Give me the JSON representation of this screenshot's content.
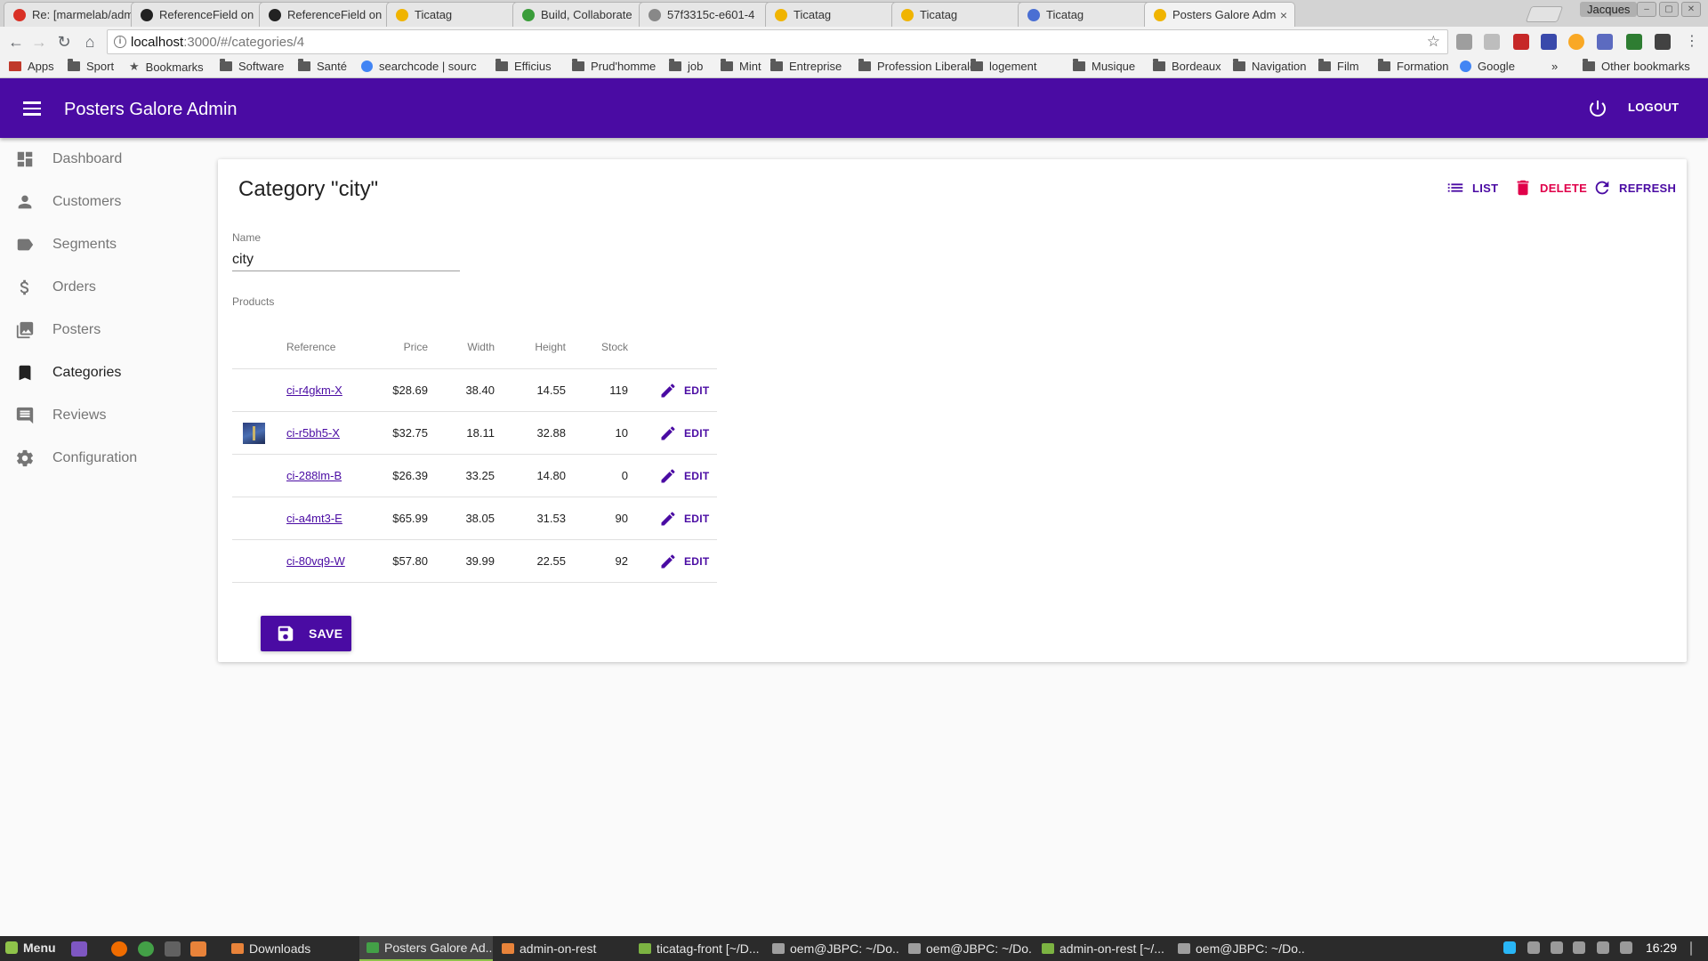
{
  "browser": {
    "tabs": [
      {
        "title": "Re: [marmelab/admin-on-rest",
        "favicon_color": "#d93025"
      },
      {
        "title": "ReferenceField on",
        "favicon_color": "#222222"
      },
      {
        "title": "ReferenceField on",
        "favicon_color": "#222222"
      },
      {
        "title": "Ticatag",
        "favicon_color": "#f0b400"
      },
      {
        "title": "Build, Collaborate",
        "favicon_color": "#3a9d3a"
      },
      {
        "title": "57f3315c-e601-4",
        "favicon_color": "#888888"
      },
      {
        "title": "Ticatag",
        "favicon_color": "#f0b400"
      },
      {
        "title": "Ticatag",
        "favicon_color": "#f0b400"
      },
      {
        "title": "Ticatag",
        "favicon_color": "#4a6fd3"
      },
      {
        "title": "Posters Galore Admin",
        "favicon_color": "#f0b400"
      }
    ],
    "user": "Jacques",
    "url_host": "localhost",
    "url_path": ":3000/#/categories/4",
    "bookmarks": [
      {
        "label": "Apps",
        "type": "apps"
      },
      {
        "label": "Sport",
        "type": "folder"
      },
      {
        "label": "Bookmarks",
        "type": "star"
      },
      {
        "label": "Software",
        "type": "folder"
      },
      {
        "label": "Santé",
        "type": "folder"
      },
      {
        "label": "searchcode | sourc",
        "type": "site"
      },
      {
        "label": "Efficius",
        "type": "folder"
      },
      {
        "label": "Prud'homme",
        "type": "folder"
      },
      {
        "label": "job",
        "type": "folder"
      },
      {
        "label": "Mint",
        "type": "folder"
      },
      {
        "label": "Entreprise",
        "type": "folder"
      },
      {
        "label": "Profession Liberale",
        "type": "folder"
      },
      {
        "label": "logement",
        "type": "folder"
      },
      {
        "label": "Musique",
        "type": "folder"
      },
      {
        "label": "Bordeaux",
        "type": "folder"
      },
      {
        "label": "Navigation",
        "type": "folder"
      },
      {
        "label": "Film",
        "type": "folder"
      },
      {
        "label": "Formation",
        "type": "folder"
      },
      {
        "label": "Google",
        "type": "site"
      },
      {
        "label": "»",
        "type": "more"
      },
      {
        "label": "Other bookmarks",
        "type": "folder"
      }
    ]
  },
  "app": {
    "title": "Posters Galore Admin",
    "logout_label": "LOGOUT",
    "accent_color": "#4a0ba3",
    "danger_color": "#e0004a"
  },
  "sidebar": {
    "items": [
      {
        "label": "Dashboard",
        "icon": "dashboard-icon",
        "active": false
      },
      {
        "label": "Customers",
        "icon": "person-icon",
        "active": false
      },
      {
        "label": "Segments",
        "icon": "label-icon",
        "active": false
      },
      {
        "label": "Orders",
        "icon": "dollar-icon",
        "active": false
      },
      {
        "label": "Posters",
        "icon": "collections-icon",
        "active": false
      },
      {
        "label": "Categories",
        "icon": "bookmark-icon",
        "active": true
      },
      {
        "label": "Reviews",
        "icon": "comment-icon",
        "active": false
      },
      {
        "label": "Configuration",
        "icon": "settings-icon",
        "active": false
      }
    ]
  },
  "page": {
    "title": "Category \"city\"",
    "actions": {
      "list": "LIST",
      "delete": "DELETE",
      "refresh": "REFRESH"
    },
    "name_label": "Name",
    "name_value": "city",
    "products_label": "Products",
    "save_label": "SAVE"
  },
  "products": {
    "columns": [
      "Reference",
      "Price",
      "Width",
      "Height",
      "Stock"
    ],
    "edit_label": "EDIT",
    "rows": [
      {
        "reference": "ci-r4gkm-X",
        "price": "$28.69",
        "width": "38.40",
        "height": "14.55",
        "stock": "119",
        "thumb": false
      },
      {
        "reference": "ci-r5bh5-X",
        "price": "$32.75",
        "width": "18.11",
        "height": "32.88",
        "stock": "10",
        "thumb": true
      },
      {
        "reference": "ci-288lm-B",
        "price": "$26.39",
        "width": "33.25",
        "height": "14.80",
        "stock": "0",
        "thumb": false
      },
      {
        "reference": "ci-a4mt3-E",
        "price": "$65.99",
        "width": "38.05",
        "height": "31.53",
        "stock": "90",
        "thumb": false
      },
      {
        "reference": "ci-80vq9-W",
        "price": "$57.80",
        "width": "39.99",
        "height": "22.55",
        "stock": "92",
        "thumb": false
      }
    ]
  },
  "taskbar": {
    "menu_label": "Menu",
    "windows": [
      {
        "label": "Downloads",
        "active": false
      },
      {
        "label": "Posters Galore Ad...",
        "active": true
      },
      {
        "label": "admin-on-rest",
        "active": false
      },
      {
        "label": "ticatag-front [~/D...",
        "active": false
      },
      {
        "label": "oem@JBPC: ~/Do...",
        "active": false
      },
      {
        "label": "oem@JBPC: ~/Do...",
        "active": false
      },
      {
        "label": "admin-on-rest [~/...",
        "active": false
      },
      {
        "label": "oem@JBPC: ~/Do...",
        "active": false
      }
    ],
    "clock": "16:29"
  }
}
